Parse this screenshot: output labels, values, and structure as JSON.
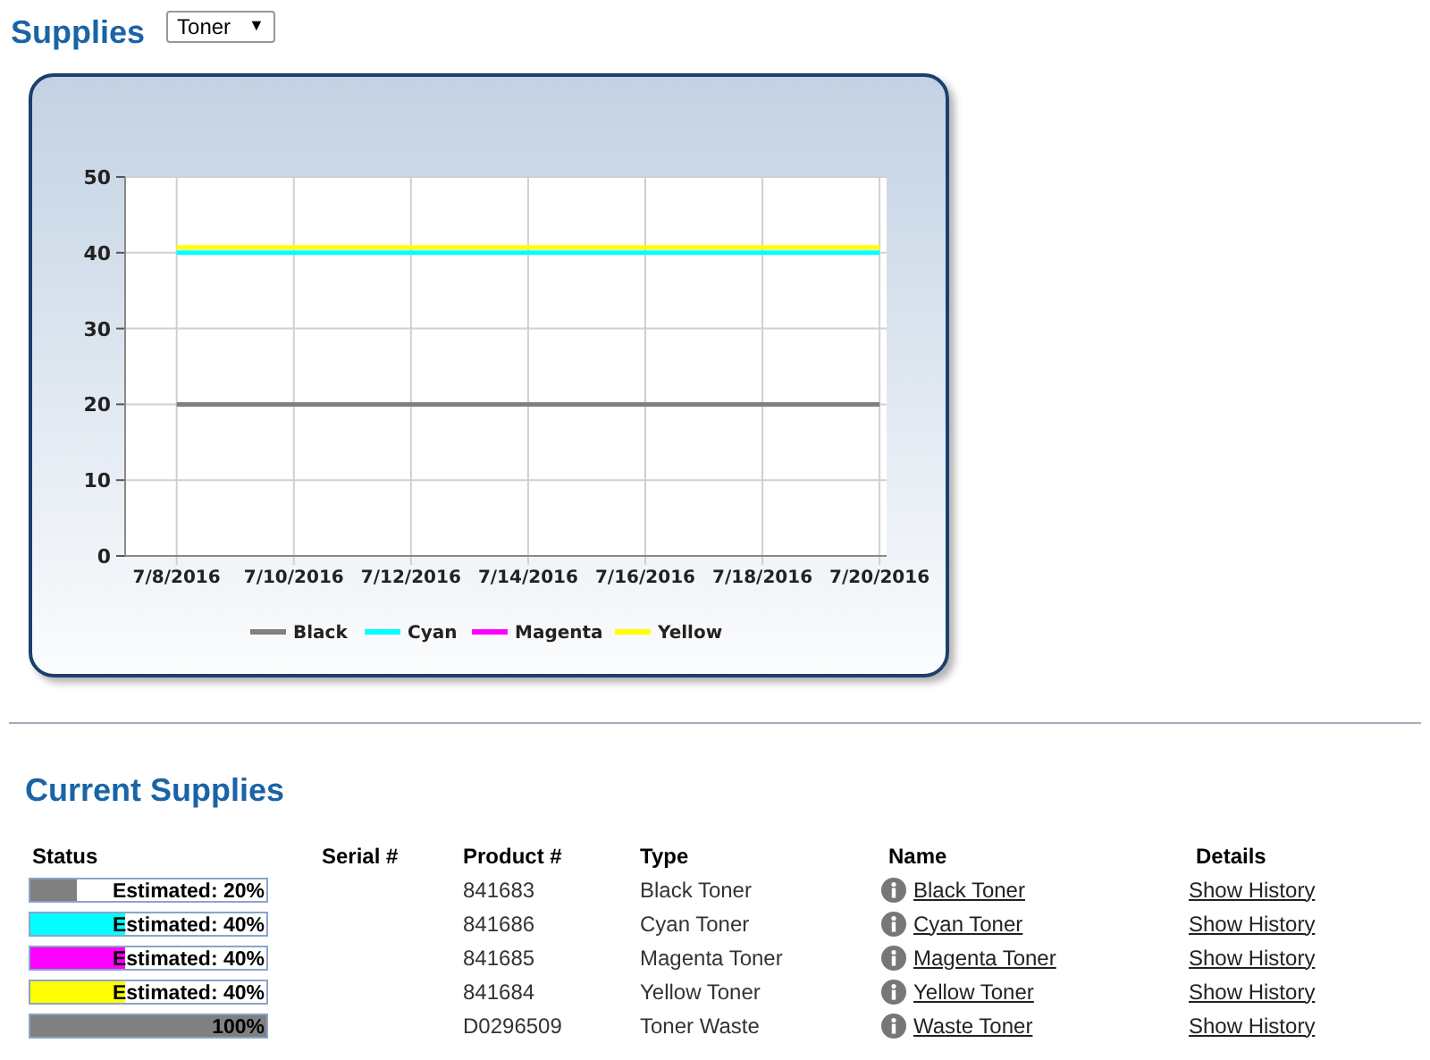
{
  "header": {
    "title": "Supplies",
    "dropdown": {
      "value": "Toner",
      "arrow": "▼"
    }
  },
  "history_chart": {
    "chart_data": {
      "type": "line",
      "categories": [
        "7/8/2016",
        "7/10/2016",
        "7/12/2016",
        "7/14/2016",
        "7/16/2016",
        "7/18/2016",
        "7/20/2016"
      ],
      "series": [
        {
          "name": "Black",
          "color": "#808080",
          "values": [
            20,
            20,
            20,
            20,
            20,
            20,
            20
          ]
        },
        {
          "name": "Cyan",
          "color": "#00ffff",
          "values": [
            40,
            40,
            40,
            40,
            40,
            40,
            40
          ]
        },
        {
          "name": "Magenta",
          "color": "#ff00ff",
          "values": [
            null,
            null,
            null,
            null,
            null,
            null,
            null
          ]
        },
        {
          "name": "Yellow",
          "color": "#ffff00",
          "values": [
            40.7,
            40.7,
            40.7,
            40.7,
            40.7,
            40.7,
            40.7
          ]
        }
      ],
      "ylim": [
        0,
        50
      ],
      "yticks": [
        0,
        10,
        20,
        30,
        40,
        50
      ],
      "grid": true,
      "legend": true
    }
  },
  "current_supplies": {
    "title": "Current Supplies",
    "columns": [
      "Status",
      "Serial #",
      "Product #",
      "Type",
      "Name",
      "Details"
    ],
    "rows": [
      {
        "status": {
          "label": "Estimated: 20%",
          "level": 0.2,
          "color": "#808080"
        },
        "product": "841683",
        "type": "Black Toner",
        "name": "Black Toner",
        "details": "Show History"
      },
      {
        "status": {
          "label": "Estimated: 40%",
          "level": 0.4,
          "color": "#00ffff"
        },
        "product": "841686",
        "type": "Cyan Toner",
        "name": "Cyan Toner",
        "details": "Show History"
      },
      {
        "status": {
          "label": "Estimated: 40%",
          "level": 0.4,
          "color": "#ff00ff"
        },
        "product": "841685",
        "type": "Magenta Toner",
        "name": "Magenta Toner",
        "details": "Show History"
      },
      {
        "status": {
          "label": "Estimated: 40%",
          "level": 0.4,
          "color": "#ffff00"
        },
        "product": "841684",
        "type": "Yellow Toner",
        "name": "Yellow Toner",
        "details": "Show History"
      },
      {
        "status": {
          "label": "100%",
          "level": 1,
          "color": "#808080"
        },
        "product": "D0296509",
        "type": "Toner Waste",
        "name": "Waste Toner",
        "details": "Show History"
      }
    ]
  }
}
